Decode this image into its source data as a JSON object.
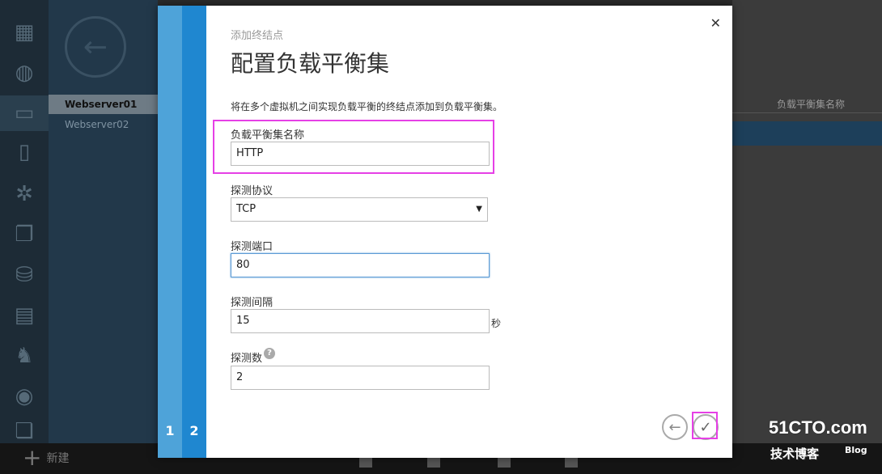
{
  "background": {
    "nav_icons": [
      "grid-icon",
      "globe-icon",
      "monitor-icon",
      "mobile-icon",
      "gears-icon",
      "transfer-icon",
      "db-icon",
      "table-icon",
      "elephant-icon",
      "media-icon",
      "docs-icon"
    ],
    "servers": [
      "Webserver01",
      "Webserver02"
    ],
    "column_header": "负载平衡集名称",
    "new_label": "新建"
  },
  "dialog": {
    "steps": [
      "1",
      "2"
    ],
    "breadcrumb": "添加终结点",
    "title": "配置负载平衡集",
    "description": "将在多个虚拟机之间实现负载平衡的终结点添加到负载平衡集。",
    "fields": {
      "lb_name": {
        "label": "负载平衡集名称",
        "value": "HTTP"
      },
      "probe_protocol": {
        "label": "探测协议",
        "value": "TCP"
      },
      "probe_port": {
        "label": "探测端口",
        "value": "80"
      },
      "probe_interval": {
        "label": "探测间隔",
        "value": "15",
        "unit": "秒"
      },
      "probe_count": {
        "label": "探测数",
        "value": "2"
      }
    },
    "close_glyph": "✕",
    "help_glyph": "?",
    "back_glyph": "←",
    "done_glyph": "✓"
  },
  "watermark": {
    "main": "51CTO.com",
    "sub": "技术博客",
    "blog": "Blog"
  },
  "colors": {
    "step1": "#4ea3d9",
    "step2": "#1f87d0",
    "highlight": "#e640e6"
  }
}
